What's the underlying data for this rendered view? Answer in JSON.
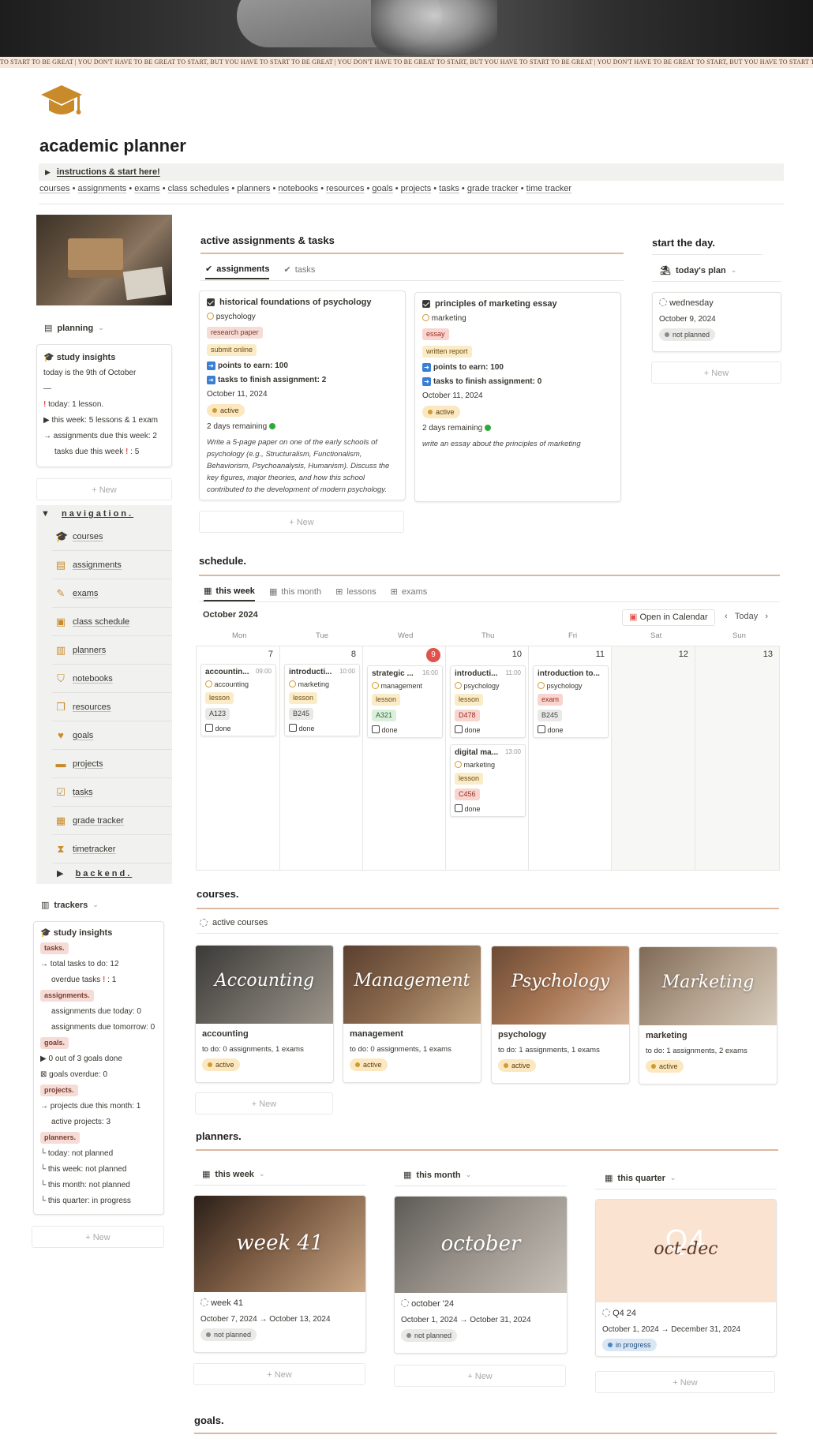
{
  "ticker": "TO START TO BE GREAT | YOU DON'T HAVE TO BE GREAT TO START, BUT YOU HAVE TO START TO BE GREAT | YOU DON'T HAVE TO BE GREAT TO START, BUT YOU HAVE TO START TO BE GREAT | YOU DON'T HAVE TO BE GREAT TO START, BUT YOU HAVE TO START TO BE GREAT | YOU DON'T HAVE TO BE GREAT TO START, BUT YOU HAVE TO START TO BE GREAT",
  "page": {
    "title": "academic planner",
    "icon": "graduation-cap-icon",
    "toggle": "instructions & start here!"
  },
  "breadcrumbs": [
    "courses",
    "assignments",
    "exams",
    "class schedules",
    "planners",
    "notebooks",
    "resources",
    "goals",
    "projects",
    "tasks",
    "grade tracker",
    "time tracker"
  ],
  "sidebar": {
    "planning_view": "planning",
    "study_insights": {
      "title": "study insights",
      "lines": [
        "today is the 9th of October",
        "—",
        "today: 1 lesson.",
        "this week: 5 lessons & 1 exam",
        "assignments due this week: 2",
        "tasks due this week",
        ": 5"
      ]
    },
    "new_label": "New",
    "nav_title": "navigation.",
    "nav_items": [
      "courses",
      "assignments",
      "exams",
      "class schedule",
      "planners",
      "notebooks",
      "resources",
      "goals",
      "projects",
      "tasks",
      "grade tracker",
      "timetracker"
    ],
    "backend": "backend.",
    "trackers_view": "trackers",
    "tracker_insights": {
      "title": "study insights",
      "tasks_h": "tasks.",
      "total_tasks": "total tasks to do: 12",
      "overdue": "overdue tasks",
      "overdue_val": ": 1",
      "assign_h": "assignments.",
      "due_today": "assignments due today: 0",
      "due_tomorrow": "assignments due tomorrow: 0",
      "goals_h": "goals.",
      "goals_done": "0 out of 3 goals done",
      "goals_overdue": "goals overdue: 0",
      "projects_h": "projects.",
      "projects_due": "projects due this month: 1",
      "active_projects": "active projects: 3",
      "planners_h": "planners.",
      "p_today": "today: not planned",
      "p_week": "this week: not planned",
      "p_month": "this month: not planned",
      "p_quarter": "this quarter: in progress"
    }
  },
  "active": {
    "title": "active assignments & tasks",
    "tabs": [
      "assignments",
      "tasks"
    ],
    "cards": [
      {
        "title": "historical foundations of psychology",
        "course": "psychology",
        "tags": [
          "research paper",
          "submit online"
        ],
        "points": "points to earn: 100",
        "tasks": "tasks to finish assignment: 2",
        "date": "October 11, 2024",
        "status": "active",
        "remaining": "2 days remaining",
        "desc": "Write a 5-page paper on one of the early schools of psychology (e.g., Structuralism, Functionalism, Behaviorism, Psychoanalysis, Humanism). Discuss the key figures, major theories, and how this school contributed to the development of modern psychology."
      },
      {
        "title": "principles of marketing essay",
        "course": "marketing",
        "tags": [
          "essay",
          "written report"
        ],
        "points": "points to earn: 100",
        "tasks": "tasks to finish assignment: 0",
        "date": "October 11, 2024",
        "status": "active",
        "remaining": "2 days remaining",
        "desc": "write an essay about the principles of marketing"
      }
    ],
    "new_label": "New"
  },
  "start_day": {
    "title": "start the day.",
    "view": "today's plan",
    "card_title": "wednesday",
    "date": "October 9, 2024",
    "status": "not planned",
    "new_label": "New"
  },
  "schedule": {
    "title": "schedule.",
    "tabs": [
      "this week",
      "this month",
      "lessons",
      "exams"
    ],
    "month": "October 2024",
    "open_calendar": "Open in Calendar",
    "today_btn": "Today",
    "days": [
      "Mon",
      "Tue",
      "Wed",
      "Thu",
      "Fri",
      "Sat",
      "Sun"
    ],
    "dates": [
      "7",
      "8",
      "9",
      "10",
      "11",
      "12",
      "13"
    ],
    "events": [
      {
        "title": "accountin...",
        "time": "09:00",
        "course": "accounting",
        "kind": "lesson",
        "room": "A123",
        "done": "done"
      },
      {
        "title": "introducti...",
        "time": "10:00",
        "course": "marketing",
        "kind": "lesson",
        "room": "B245",
        "done": "done"
      },
      {
        "title": "strategic ...",
        "time": "16:00",
        "course": "management",
        "kind": "lesson",
        "room": "A321",
        "done": "done"
      },
      {
        "title": "introducti...",
        "time": "11:00",
        "course": "psychology",
        "kind": "lesson",
        "room": "D478",
        "done": "done"
      },
      {
        "title": "introduction to...",
        "time": "",
        "course": "psychology",
        "kind": "exam",
        "room": "B245",
        "done": "done"
      },
      {
        "title": "digital ma...",
        "time": "13:00",
        "course": "marketing",
        "kind": "lesson",
        "room": "C456",
        "done": "done"
      }
    ]
  },
  "courses": {
    "title": "courses.",
    "view": "active courses",
    "items": [
      {
        "script": "Accounting",
        "name": "accounting",
        "todo": "to do: 0 assignments, 1 exams",
        "status": "active"
      },
      {
        "script": "Management",
        "name": "management",
        "todo": "to do: 0 assignments, 1 exams",
        "status": "active"
      },
      {
        "script": "Psychology",
        "name": "psychology",
        "todo": "to do: 1 assignments, 1 exams",
        "status": "active"
      },
      {
        "script": "Marketing",
        "name": "marketing",
        "todo": "to do: 1 assignments, 2 exams",
        "status": "active"
      }
    ],
    "new_label": "New"
  },
  "planners": {
    "title": "planners.",
    "cols": [
      {
        "view": "this week",
        "script": "week 41",
        "name": "week 41",
        "range": "October 7, 2024 → October 13, 2024",
        "status": "not planned"
      },
      {
        "view": "this month",
        "script": "october",
        "name": "october '24",
        "range": "October 1, 2024 → October 31, 2024",
        "status": "not planned"
      },
      {
        "view": "this quarter",
        "script": "oct-dec",
        "script_big": "Q4",
        "name": "Q4 24",
        "range": "October 1, 2024 → December 31, 2024",
        "status": "in progress"
      }
    ],
    "new_label": "New"
  },
  "goals": {
    "title": "goals."
  }
}
